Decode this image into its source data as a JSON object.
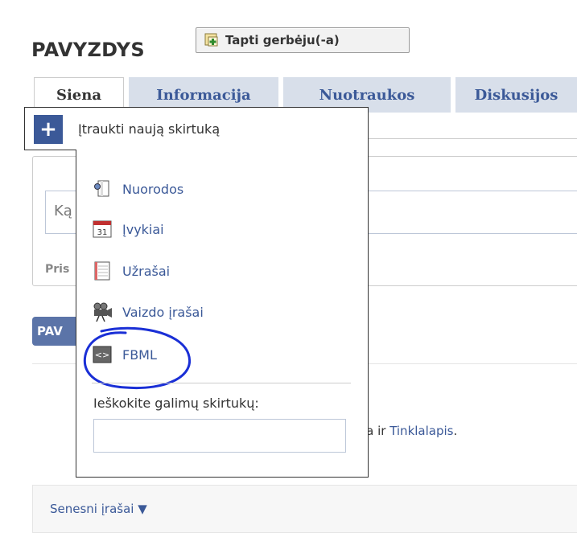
{
  "page": {
    "title": "PAVYZDYS",
    "fan_button_label": "Tapti gerbėju(-a)"
  },
  "tabs": [
    {
      "label": "Siena",
      "active": true
    },
    {
      "label": "Informacija",
      "active": false
    },
    {
      "label": "Nuotraukos",
      "active": false
    },
    {
      "label": "Diskusijos",
      "active": false
    }
  ],
  "background": {
    "input_text_fragment": "Ką",
    "share_fragment": "Pris",
    "badge_fragment": "PAV",
    "text_fragment": "eta ir ",
    "link_fragment": "Tinklalapis",
    "text_end": ".",
    "older_posts": "Senesni įrašai ▼"
  },
  "dropdown": {
    "add_tab_label": "Įtraukti naują skirtuką",
    "items": [
      {
        "label": "Nuorodos",
        "icon": "links-icon"
      },
      {
        "label": "Įvykiai",
        "icon": "calendar-icon"
      },
      {
        "label": "Užrašai",
        "icon": "notes-icon"
      },
      {
        "label": "Vaizdo įrašai",
        "icon": "video-camera-icon"
      },
      {
        "label": "FBML",
        "icon": "fbml-icon"
      }
    ],
    "search_label": "Ieškokite galimų skirtukų:",
    "search_value": ""
  },
  "colors": {
    "link": "#3b5998",
    "tab_bg": "#d8dfea",
    "annotation": "#1a2fd6"
  }
}
